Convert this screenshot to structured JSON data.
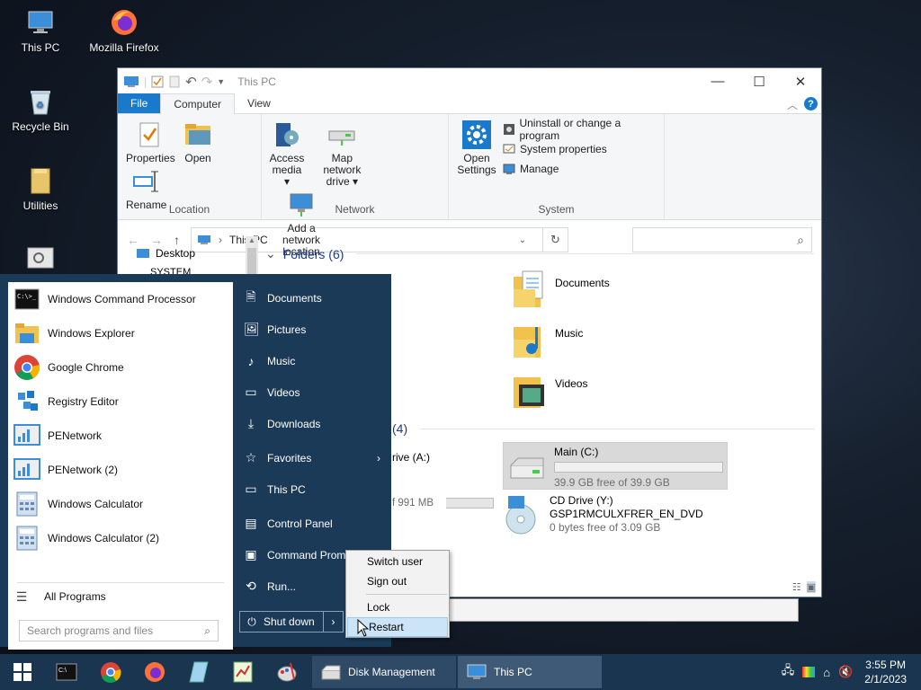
{
  "desktop": {
    "icons": [
      {
        "label": "This PC",
        "icon": "computer-icon"
      },
      {
        "label": "Mozilla Firefox",
        "icon": "firefox-icon"
      },
      {
        "label": "Recycle Bin",
        "icon": "recycle-bin-icon"
      },
      {
        "label": "Utilities",
        "icon": "folder-icon"
      }
    ]
  },
  "explorer": {
    "title": "This PC",
    "tabs": {
      "file": "File",
      "computer": "Computer",
      "view": "View"
    },
    "ribbon": {
      "location": {
        "label": "Location",
        "properties": "Properties",
        "open": "Open",
        "rename": "Rename"
      },
      "network": {
        "label": "Network",
        "access_media": "Access media ▾",
        "map_drive": "Map network drive ▾",
        "add_location": "Add a network location"
      },
      "system": {
        "label": "System",
        "open_settings": "Open Settings",
        "uninstall": "Uninstall or change a program",
        "sys_props": "System properties",
        "manage": "Manage"
      }
    },
    "address": "This PC",
    "nav": {
      "desktop": "Desktop",
      "system": "SYSTEM"
    },
    "folders_header": "Folders (6)",
    "folders": [
      "Documents",
      "Music",
      "Videos"
    ],
    "devices_header_partial": "(4)",
    "drives": {
      "floppy_partial": "rive (A:)",
      "floppy_free_partial": "f 991 MB",
      "main_name": "Main (C:)",
      "main_free": "39.9 GB free of 39.9 GB",
      "main_used_fraction": 0.0,
      "cd_name": "CD Drive (Y:)",
      "cd_label": "GSP1RMCULXFRER_EN_DVD",
      "cd_free": "0 bytes free of 3.09 GB"
    }
  },
  "start_menu": {
    "programs": [
      {
        "label": "Windows Command Processor",
        "icon": "cmd-icon"
      },
      {
        "label": "Windows Explorer",
        "icon": "explorer-folder-icon"
      },
      {
        "label": "Google Chrome",
        "icon": "chrome-icon"
      },
      {
        "label": "Registry Editor",
        "icon": "registry-icon"
      },
      {
        "label": "PENetwork",
        "icon": "network-icon"
      },
      {
        "label": "PENetwork (2)",
        "icon": "network-icon"
      },
      {
        "label": "Windows Calculator",
        "icon": "calculator-icon"
      },
      {
        "label": "Windows Calculator (2)",
        "icon": "calculator-icon"
      }
    ],
    "all_programs": "All Programs",
    "search_placeholder": "Search programs and files",
    "places": [
      "Documents",
      "Pictures",
      "Music",
      "Videos",
      "Downloads",
      "Favorites",
      "This PC",
      "Control Panel",
      "Command Prom",
      "Run..."
    ],
    "shutdown": "Shut down"
  },
  "context_menu": [
    "Switch user",
    "Sign out",
    "Lock",
    "Restart"
  ],
  "taskbar": {
    "disk_management": "Disk Management",
    "this_pc": "This PC",
    "time": "3:55 PM",
    "date": "2/1/2023"
  }
}
